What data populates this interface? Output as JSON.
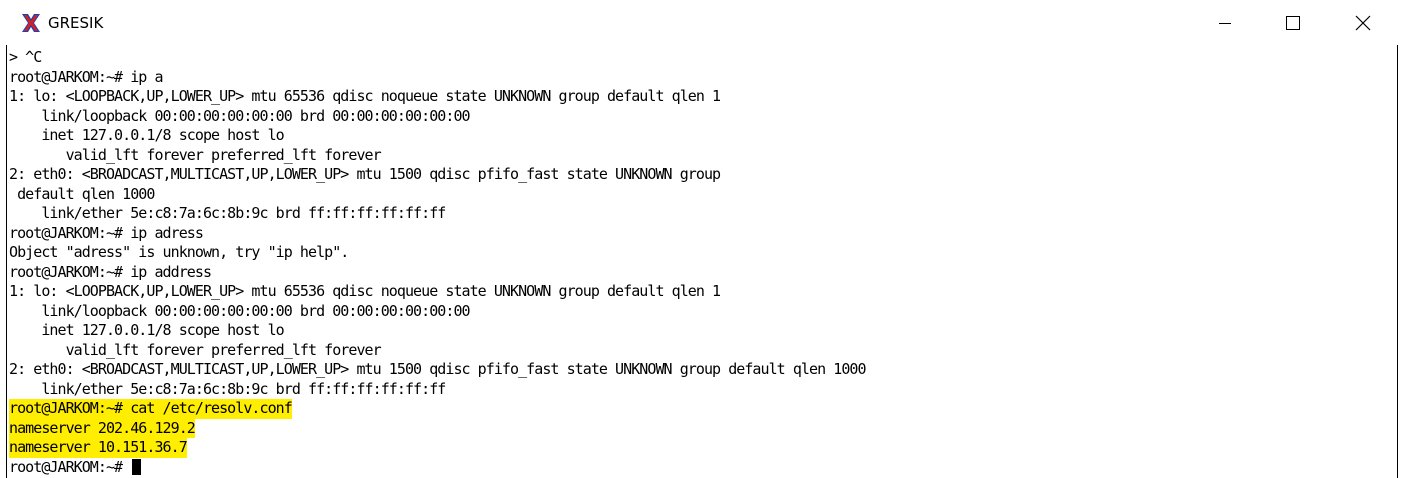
{
  "window": {
    "title": "GRESIK",
    "app_icon": "x-logo-icon",
    "controls": {
      "minimize_icon": "minimize-icon",
      "maximize_icon": "maximize-icon",
      "close_icon": "close-icon"
    }
  },
  "terminal": {
    "lines": [
      "> ^C",
      "root@JARKOM:~# ip a",
      "1: lo: <LOOPBACK,UP,LOWER_UP> mtu 65536 qdisc noqueue state UNKNOWN group default qlen 1",
      "    link/loopback 00:00:00:00:00:00 brd 00:00:00:00:00:00",
      "    inet 127.0.0.1/8 scope host lo",
      "       valid_lft forever preferred_lft forever",
      "2: eth0: <BROADCAST,MULTICAST,UP,LOWER_UP> mtu 1500 qdisc pfifo_fast state UNKNOWN group",
      " default qlen 1000",
      "    link/ether 5e:c8:7a:6c:8b:9c brd ff:ff:ff:ff:ff:ff",
      "root@JARKOM:~# ip adress",
      "Object \"adress\" is unknown, try \"ip help\".",
      "root@JARKOM:~# ip address",
      "1: lo: <LOOPBACK,UP,LOWER_UP> mtu 65536 qdisc noqueue state UNKNOWN group default qlen 1",
      "    link/loopback 00:00:00:00:00:00 brd 00:00:00:00:00:00",
      "    inet 127.0.0.1/8 scope host lo",
      "       valid_lft forever preferred_lft forever",
      "2: eth0: <BROADCAST,MULTICAST,UP,LOWER_UP> mtu 1500 qdisc pfifo_fast state UNKNOWN group default qlen 1000",
      "    link/ether 5e:c8:7a:6c:8b:9c brd ff:ff:ff:ff:ff:ff"
    ],
    "highlighted_lines": [
      "root@JARKOM:~# cat /etc/resolv.conf",
      "nameserver 202.46.129.2",
      "nameserver 10.151.36.7"
    ],
    "prompt": "root@JARKOM:~# ",
    "highlight_color": "#ffee00"
  }
}
